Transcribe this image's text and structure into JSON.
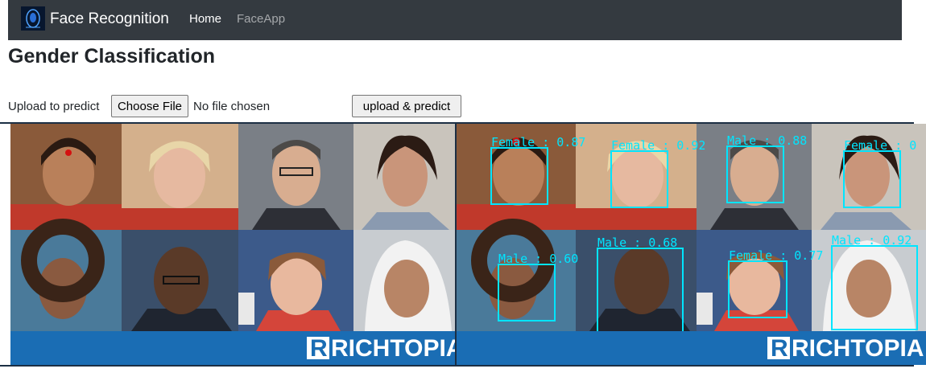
{
  "navbar": {
    "brand": "Face Recognition",
    "links": [
      {
        "label": "Home",
        "active": true
      },
      {
        "label": "FaceApp",
        "active": false
      }
    ],
    "background": "#343a40"
  },
  "page": {
    "title": "Gender Classification"
  },
  "upload": {
    "label": "Upload to predict",
    "choose_button": "Choose File",
    "file_status": "No file chosen",
    "submit_button": "upload & predict"
  },
  "images": {
    "watermark": "RICHTOPIA",
    "box_color": "#00e5ff",
    "detections": [
      {
        "label": "Female : 0.87"
      },
      {
        "label": "Female : 0.92"
      },
      {
        "label": "Male : 0.88"
      },
      {
        "label": "Female : 0"
      },
      {
        "label": "Male : 0.60"
      },
      {
        "label": "Male : 0.68"
      },
      {
        "label": "Female : 0.77"
      },
      {
        "label": "Male : 0.92"
      }
    ]
  }
}
